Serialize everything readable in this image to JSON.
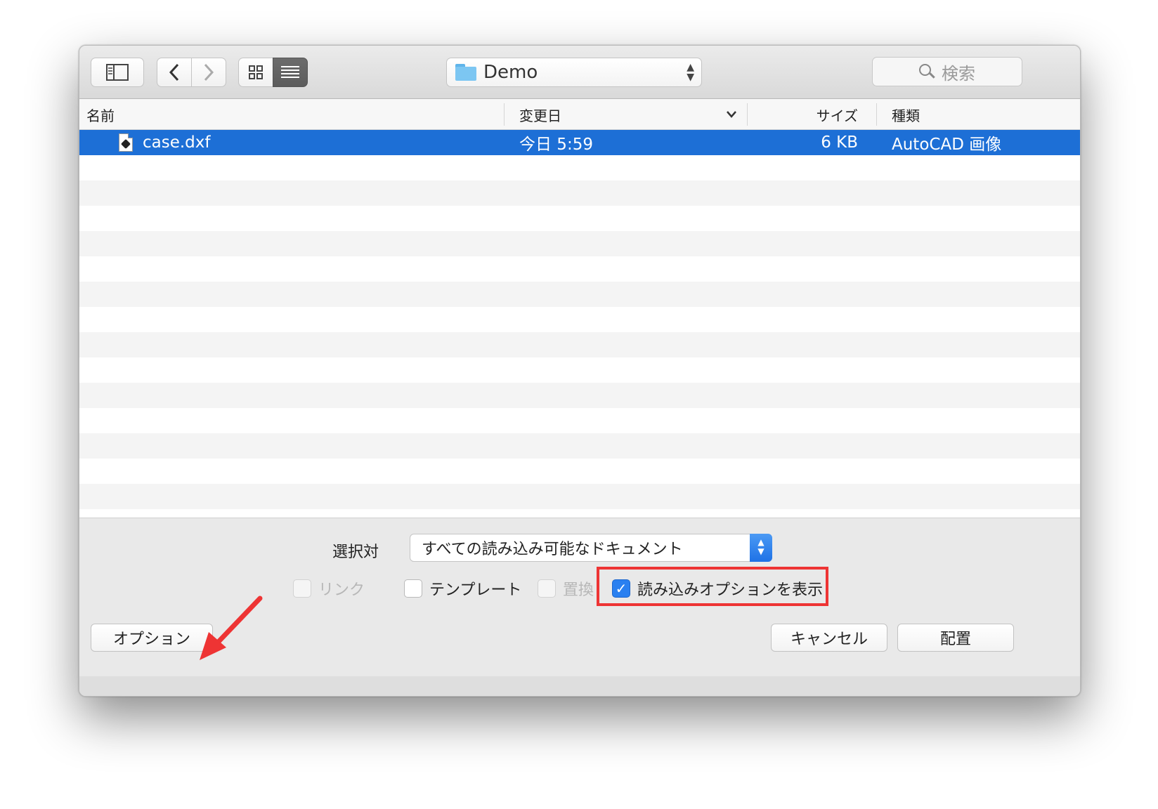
{
  "toolbar": {
    "path": "Demo",
    "search_placeholder": "検索"
  },
  "columns": {
    "name": "名前",
    "date": "変更日",
    "size": "サイズ",
    "kind": "種類"
  },
  "files": [
    {
      "name": "case.dxf",
      "date": "今日 5:59",
      "size": "6 KB",
      "kind": "AutoCAD 画像"
    }
  ],
  "bottom": {
    "enable_label": "選択対",
    "enable_value": "すべての読み込み可能なドキュメント",
    "checkboxes": {
      "link": "リンク",
      "template": "テンプレート",
      "replace": "置換",
      "show_import_options": "読み込みオプションを表示"
    },
    "options_button": "オプション",
    "cancel_button": "キャンセル",
    "place_button": "配置"
  },
  "colors": {
    "selection": "#1d6fd6",
    "highlight": "#ee3434",
    "arrow": "#ee3434"
  }
}
